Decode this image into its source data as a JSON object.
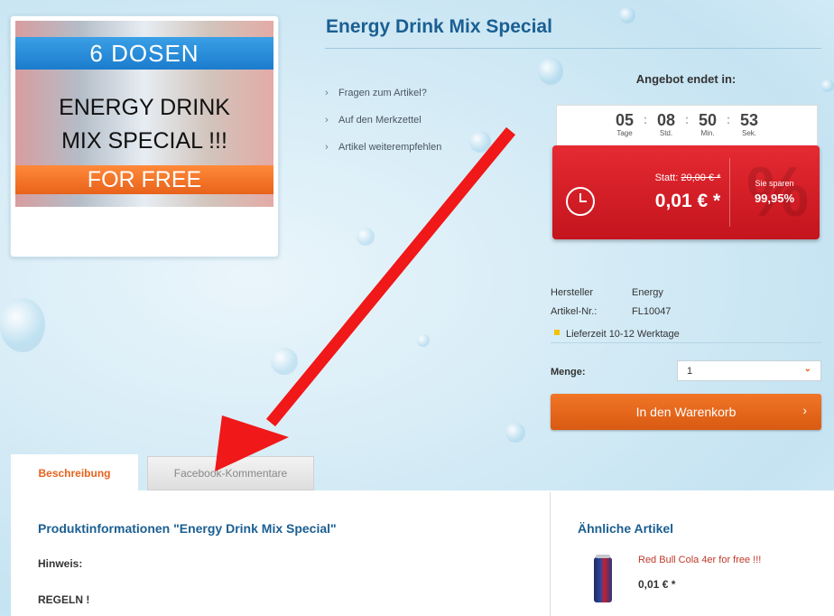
{
  "product": {
    "title": "Energy Drink Mix Special",
    "image": {
      "top_banner": "6 DOSEN",
      "line1": "ENERGY DRINK",
      "line2": "MIX SPECIAL !!!",
      "bottom_banner": "FOR FREE"
    }
  },
  "actions": [
    {
      "label": "Fragen zum Artikel?"
    },
    {
      "label": "Auf den Merkzettel"
    },
    {
      "label": "Artikel weiterempfehlen"
    }
  ],
  "offer": {
    "heading": "Angebot endet in:",
    "countdown": [
      {
        "value": "05",
        "label": "Tage"
      },
      {
        "value": "08",
        "label": "Std."
      },
      {
        "value": "50",
        "label": "Min."
      },
      {
        "value": "53",
        "label": "Sek."
      }
    ],
    "old_price_prefix": "Statt:",
    "old_price": "20,00 € *",
    "new_price": "0,01 € *",
    "savings_label": "Sie sparen",
    "savings_value": "99,95%"
  },
  "details": {
    "manufacturer_label": "Hersteller",
    "manufacturer_value": "Energy",
    "sku_label": "Artikel-Nr.:",
    "sku_value": "FL10047",
    "delivery": "Lieferzeit 10-12 Werktage",
    "delivery_color": "#f3c200"
  },
  "quantity": {
    "label": "Menge:",
    "selected": "1"
  },
  "cart_button": {
    "label": "In den Warenkorb"
  },
  "tabs": [
    {
      "label": "Beschreibung",
      "active": true
    },
    {
      "label": "Facebook-Kommentare",
      "active": false
    }
  ],
  "description": {
    "title": "Produktinformationen \"Energy Drink Mix Special\"",
    "hint": "Hinweis:",
    "rules": "REGELN !"
  },
  "similar": {
    "title": "Ähnliche Artikel",
    "items": [
      {
        "name": "Red Bull Cola 4er for free !!!",
        "price": "0,01 € *"
      }
    ]
  },
  "colors": {
    "accent_orange": "#e8621b",
    "price_red": "#d01f28",
    "heading_blue": "#1b5f92",
    "annotation_arrow": "#f01818"
  }
}
